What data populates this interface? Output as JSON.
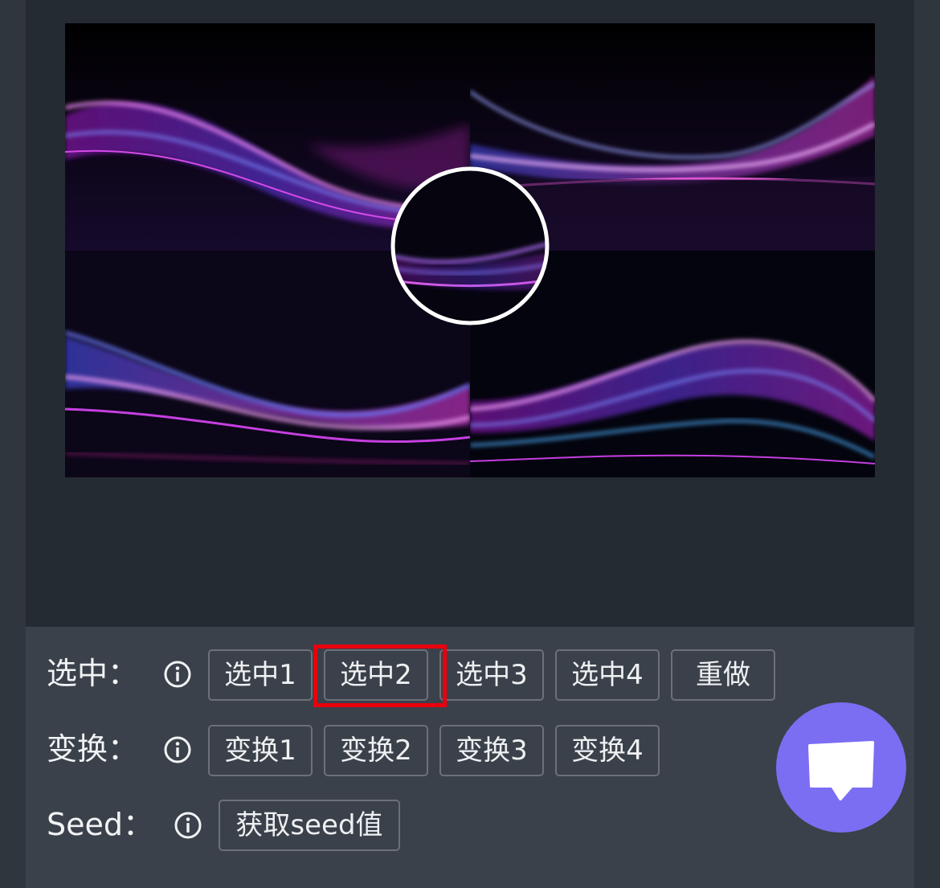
{
  "preview": {
    "image": "four-panel abstract neon wave grid",
    "selected_quadrant_marker": "circle-magnifier"
  },
  "rows": {
    "select": {
      "label": "选中：",
      "info_icon": "info-icon",
      "buttons": [
        "选中1",
        "选中2",
        "选中3",
        "选中4",
        "重做"
      ],
      "highlighted": "选中2"
    },
    "variation": {
      "label": "变换：",
      "info_icon": "info-icon",
      "buttons": [
        "变换1",
        "变换2",
        "变换3",
        "变换4"
      ]
    },
    "seed": {
      "label": "Seed：",
      "info_icon": "info-icon",
      "button": "获取seed值"
    }
  },
  "chat": {
    "icon": "chat-bubble-icon"
  },
  "colors": {
    "background": "#2f363e",
    "panel": "#252b33",
    "controls": "#3b414a",
    "highlight_border": "#e8000d",
    "chat_fab": "#7b6ef2"
  }
}
